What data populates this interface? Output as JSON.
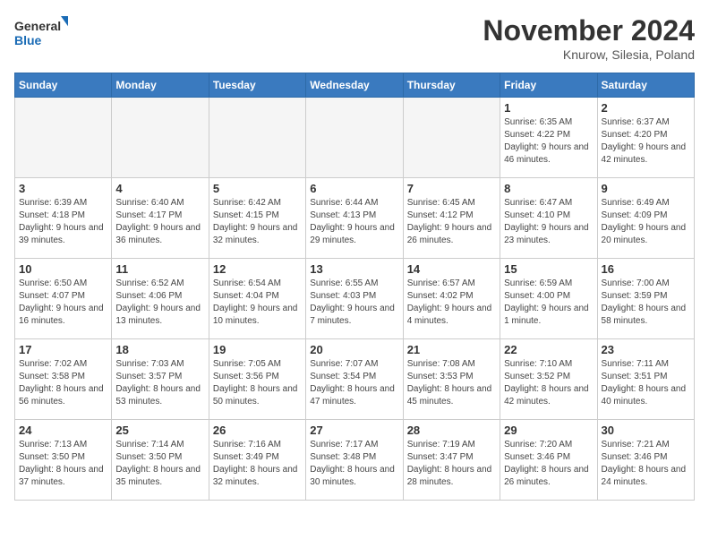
{
  "logo": {
    "general": "General",
    "blue": "Blue"
  },
  "header": {
    "month": "November 2024",
    "location": "Knurow, Silesia, Poland"
  },
  "weekdays": [
    "Sunday",
    "Monday",
    "Tuesday",
    "Wednesday",
    "Thursday",
    "Friday",
    "Saturday"
  ],
  "weeks": [
    [
      {
        "day": "",
        "info": ""
      },
      {
        "day": "",
        "info": ""
      },
      {
        "day": "",
        "info": ""
      },
      {
        "day": "",
        "info": ""
      },
      {
        "day": "",
        "info": ""
      },
      {
        "day": "1",
        "info": "Sunrise: 6:35 AM\nSunset: 4:22 PM\nDaylight: 9 hours and 46 minutes."
      },
      {
        "day": "2",
        "info": "Sunrise: 6:37 AM\nSunset: 4:20 PM\nDaylight: 9 hours and 42 minutes."
      }
    ],
    [
      {
        "day": "3",
        "info": "Sunrise: 6:39 AM\nSunset: 4:18 PM\nDaylight: 9 hours and 39 minutes."
      },
      {
        "day": "4",
        "info": "Sunrise: 6:40 AM\nSunset: 4:17 PM\nDaylight: 9 hours and 36 minutes."
      },
      {
        "day": "5",
        "info": "Sunrise: 6:42 AM\nSunset: 4:15 PM\nDaylight: 9 hours and 32 minutes."
      },
      {
        "day": "6",
        "info": "Sunrise: 6:44 AM\nSunset: 4:13 PM\nDaylight: 9 hours and 29 minutes."
      },
      {
        "day": "7",
        "info": "Sunrise: 6:45 AM\nSunset: 4:12 PM\nDaylight: 9 hours and 26 minutes."
      },
      {
        "day": "8",
        "info": "Sunrise: 6:47 AM\nSunset: 4:10 PM\nDaylight: 9 hours and 23 minutes."
      },
      {
        "day": "9",
        "info": "Sunrise: 6:49 AM\nSunset: 4:09 PM\nDaylight: 9 hours and 20 minutes."
      }
    ],
    [
      {
        "day": "10",
        "info": "Sunrise: 6:50 AM\nSunset: 4:07 PM\nDaylight: 9 hours and 16 minutes."
      },
      {
        "day": "11",
        "info": "Sunrise: 6:52 AM\nSunset: 4:06 PM\nDaylight: 9 hours and 13 minutes."
      },
      {
        "day": "12",
        "info": "Sunrise: 6:54 AM\nSunset: 4:04 PM\nDaylight: 9 hours and 10 minutes."
      },
      {
        "day": "13",
        "info": "Sunrise: 6:55 AM\nSunset: 4:03 PM\nDaylight: 9 hours and 7 minutes."
      },
      {
        "day": "14",
        "info": "Sunrise: 6:57 AM\nSunset: 4:02 PM\nDaylight: 9 hours and 4 minutes."
      },
      {
        "day": "15",
        "info": "Sunrise: 6:59 AM\nSunset: 4:00 PM\nDaylight: 9 hours and 1 minute."
      },
      {
        "day": "16",
        "info": "Sunrise: 7:00 AM\nSunset: 3:59 PM\nDaylight: 8 hours and 58 minutes."
      }
    ],
    [
      {
        "day": "17",
        "info": "Sunrise: 7:02 AM\nSunset: 3:58 PM\nDaylight: 8 hours and 56 minutes."
      },
      {
        "day": "18",
        "info": "Sunrise: 7:03 AM\nSunset: 3:57 PM\nDaylight: 8 hours and 53 minutes."
      },
      {
        "day": "19",
        "info": "Sunrise: 7:05 AM\nSunset: 3:56 PM\nDaylight: 8 hours and 50 minutes."
      },
      {
        "day": "20",
        "info": "Sunrise: 7:07 AM\nSunset: 3:54 PM\nDaylight: 8 hours and 47 minutes."
      },
      {
        "day": "21",
        "info": "Sunrise: 7:08 AM\nSunset: 3:53 PM\nDaylight: 8 hours and 45 minutes."
      },
      {
        "day": "22",
        "info": "Sunrise: 7:10 AM\nSunset: 3:52 PM\nDaylight: 8 hours and 42 minutes."
      },
      {
        "day": "23",
        "info": "Sunrise: 7:11 AM\nSunset: 3:51 PM\nDaylight: 8 hours and 40 minutes."
      }
    ],
    [
      {
        "day": "24",
        "info": "Sunrise: 7:13 AM\nSunset: 3:50 PM\nDaylight: 8 hours and 37 minutes."
      },
      {
        "day": "25",
        "info": "Sunrise: 7:14 AM\nSunset: 3:50 PM\nDaylight: 8 hours and 35 minutes."
      },
      {
        "day": "26",
        "info": "Sunrise: 7:16 AM\nSunset: 3:49 PM\nDaylight: 8 hours and 32 minutes."
      },
      {
        "day": "27",
        "info": "Sunrise: 7:17 AM\nSunset: 3:48 PM\nDaylight: 8 hours and 30 minutes."
      },
      {
        "day": "28",
        "info": "Sunrise: 7:19 AM\nSunset: 3:47 PM\nDaylight: 8 hours and 28 minutes."
      },
      {
        "day": "29",
        "info": "Sunrise: 7:20 AM\nSunset: 3:46 PM\nDaylight: 8 hours and 26 minutes."
      },
      {
        "day": "30",
        "info": "Sunrise: 7:21 AM\nSunset: 3:46 PM\nDaylight: 8 hours and 24 minutes."
      }
    ]
  ]
}
